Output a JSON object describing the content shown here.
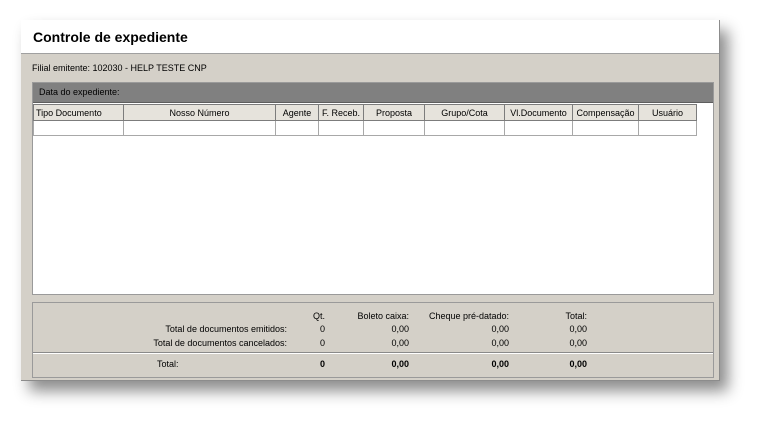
{
  "window": {
    "title": "Controle de expediente"
  },
  "filial": "Filial emitente: 102030 - HELP TESTE CNP",
  "panel": {
    "header": "Data do expediente:",
    "columns": [
      "Tipo Documento",
      "Nosso Número",
      "Agente",
      "F. Receb.",
      "Proposta",
      "Grupo/Cota",
      "Vl.Documento",
      "Compensação",
      "Usuário"
    ],
    "rows": [
      [
        "",
        "",
        "",
        "",
        "",
        "",
        "",
        "",
        ""
      ]
    ]
  },
  "totals": {
    "headers": {
      "qt": "Qt.",
      "boleto": "Boleto caixa:",
      "cheque": "Cheque pré-datado:",
      "total": "Total:"
    },
    "rows": [
      {
        "label": "Total de documentos emitidos:",
        "qt": "0",
        "boleto": "0,00",
        "cheque": "0,00",
        "total": "0,00"
      },
      {
        "label": "Total de documentos cancelados:",
        "qt": "0",
        "boleto": "0,00",
        "cheque": "0,00",
        "total": "0,00"
      }
    ],
    "grand": {
      "label": "Total:",
      "qt": "0",
      "boleto": "0,00",
      "cheque": "0,00",
      "total": "0,00"
    }
  }
}
